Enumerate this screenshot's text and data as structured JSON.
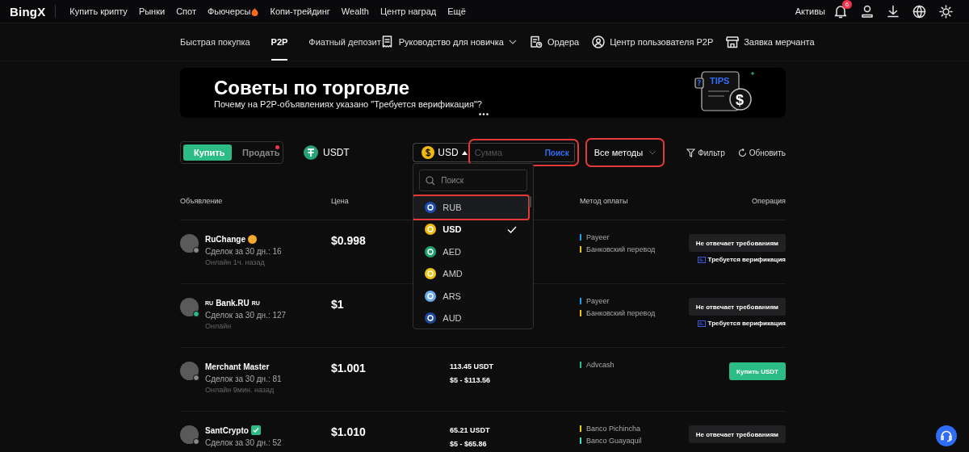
{
  "topnav": {
    "logo": "BingX",
    "items": [
      {
        "label": "Купить крипту",
        "hot": false
      },
      {
        "label": "Рынки",
        "hot": false
      },
      {
        "label": "Спот",
        "hot": false
      },
      {
        "label": "Фьючерсы",
        "hot": true
      },
      {
        "label": "Копи-трейдинг",
        "hot": false
      },
      {
        "label": "Wealth",
        "hot": false
      },
      {
        "label": "Центр наград",
        "hot": false
      },
      {
        "label": "Ещё",
        "hot": false
      }
    ],
    "assets": "Активы",
    "notifications": "6"
  },
  "subnav": {
    "tabs": [
      {
        "label": "Быстрая покупка",
        "selected": false
      },
      {
        "label": "P2P",
        "selected": true
      },
      {
        "label": "Фиатный депозит",
        "selected": false
      }
    ],
    "links": [
      {
        "kind": "guide",
        "label": "Руководство для новичка"
      },
      {
        "kind": "orders",
        "label": "Ордера"
      },
      {
        "kind": "user",
        "label": "Центр пользователя P2P"
      },
      {
        "kind": "merchant",
        "label": "Заявка мерчанта"
      }
    ]
  },
  "banner": {
    "title": "Советы по торговле",
    "subtitle": "Почему на P2P-объявлениях указано \"Требуется верификация\"?",
    "illustration_label": "TIPS",
    "illustration_symbol": "$",
    "illustration_mark": "?"
  },
  "controls": {
    "sides": [
      {
        "label": "Купить",
        "selected": true,
        "dot": false
      },
      {
        "label": "Продать",
        "selected": false,
        "dot": true
      }
    ],
    "coin": "USDT",
    "currency": {
      "value": "USD",
      "expanded": true
    },
    "amount": {
      "placeholder": "Сумма",
      "button": "Поиск",
      "annotated": true
    },
    "methods": {
      "value": "Все методы",
      "annotated": true
    },
    "filter": "Фильтр",
    "refresh": "Обновить"
  },
  "currency_menu": {
    "search_placeholder": "Поиск",
    "options": [
      {
        "code": "RUB",
        "color": "#1f4bb0",
        "selected": false,
        "hovered": true,
        "annotated": true
      },
      {
        "code": "USD",
        "color": "#f0b90b",
        "selected": true,
        "hovered": false,
        "annotated": false
      },
      {
        "code": "AED",
        "color": "#1fa36b",
        "selected": false,
        "hovered": false,
        "annotated": false
      },
      {
        "code": "AMD",
        "color": "#f0c419",
        "selected": false,
        "hovered": false,
        "annotated": false
      },
      {
        "code": "ARS",
        "color": "#6fa8e8",
        "selected": false,
        "hovered": false,
        "annotated": false
      },
      {
        "code": "AUD",
        "color": "#1f4a9a",
        "selected": false,
        "hovered": false,
        "annotated": false
      }
    ]
  },
  "table": {
    "columns": [
      "Объявление",
      "Цена",
      "Метод оплаты",
      "Операция"
    ],
    "rows": [
      {
        "name": "RuChange",
        "coin_badge": true,
        "verified": false,
        "online": false,
        "deals": "Сделок за 30 дн.: 16",
        "seen": "Онлайн 1ч. назад",
        "price": "$0.998",
        "methods": [
          {
            "label": "Payeer",
            "color": "#1ea1f2"
          },
          {
            "label": "Банковский перевод",
            "color": "#f0c419"
          }
        ],
        "operation": {
          "kind": "unavailable",
          "label": "Не отвечает требованиям",
          "note": "Требуется верификация"
        }
      },
      {
        "name": "Bank.RU",
        "tag_before": "RU",
        "tag_after": "RU",
        "coin_badge": false,
        "verified": false,
        "online": true,
        "deals": "Сделок за 30 дн.: 127",
        "seen": "Онлайн",
        "price": "$1",
        "methods": [
          {
            "label": "Payeer",
            "color": "#1ea1f2"
          },
          {
            "label": "Банковский перевод",
            "color": "#f0c419"
          }
        ],
        "operation": {
          "kind": "unavailable",
          "label": "Не отвечает требованиям",
          "note": "Требуется верификация"
        }
      },
      {
        "name": "Merchant Master",
        "coin_badge": false,
        "verified": false,
        "online": false,
        "deals": "Сделок за 30 дн.: 81",
        "seen": "Онлайн 9мин. назад",
        "price": "$1.001",
        "available": "113.45 USDT",
        "limit": "$5 - $113.56",
        "methods": [
          {
            "label": "Advcash",
            "color": "#2dbc85"
          }
        ],
        "operation": {
          "kind": "buy",
          "label": "Купить USDT"
        }
      },
      {
        "name": "SantCrypto",
        "coin_badge": false,
        "verified": true,
        "online": false,
        "deals": "Сделок за 30 дн.: 52",
        "price": "$1.010",
        "available": "65.21 USDT",
        "limit": "$5 - $65.86",
        "methods": [
          {
            "label": "Banco Pichincha",
            "color": "#f0d000"
          },
          {
            "label": "Banco Guayaquil",
            "color": "#40e0d0"
          }
        ],
        "operation": {
          "kind": "unavailable",
          "label": "Не отвечает требованиям"
        }
      }
    ]
  }
}
